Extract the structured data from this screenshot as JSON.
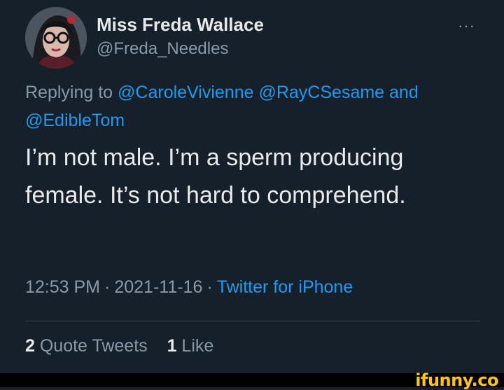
{
  "author": {
    "display_name": "Miss Freda Wallace",
    "handle": "@Freda_Needles",
    "avatar_icon": "user-avatar"
  },
  "menu": {
    "more_icon": "more-horizontal-icon",
    "more_glyph": "···"
  },
  "reply": {
    "prefix": "Replying to",
    "mention_1": "@CaroleVivienne",
    "mention_2": "@RayCSesame",
    "conjunction": "and",
    "mention_3": "@EdibleTom"
  },
  "tweet": {
    "text": "I’m not male. I’m a sperm producing female. It’s not hard to comprehend."
  },
  "meta": {
    "time": "12:53 PM",
    "separator": "·",
    "date": "2021-11-16",
    "source": "Twitter for iPhone"
  },
  "stats": {
    "quote_count": "2",
    "quote_label": "Quote Tweets",
    "like_count": "1",
    "like_label": "Like"
  },
  "watermark": {
    "text": "ifunny.co"
  },
  "colors": {
    "background": "#15202b",
    "primary_text": "#e7e9ea",
    "secondary_text": "#8b98a5",
    "link": "#1d9bf0",
    "divider": "#38444d",
    "watermark": "#ffc700"
  }
}
